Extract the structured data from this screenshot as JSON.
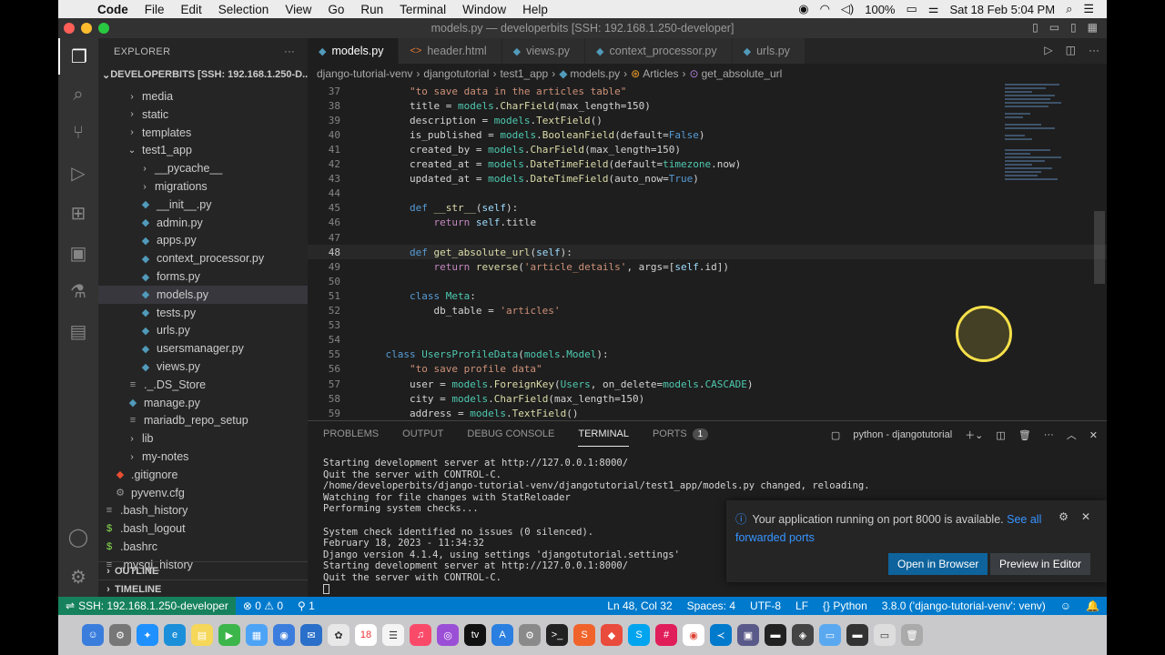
{
  "menubar": {
    "app": "Code",
    "items": [
      "File",
      "Edit",
      "Selection",
      "View",
      "Go",
      "Run",
      "Terminal",
      "Window",
      "Help"
    ],
    "battery": "100%",
    "datetime": "Sat 18 Feb  5:04 PM"
  },
  "window": {
    "title": "models.py — developerbits [SSH: 192.168.1.250-developer]"
  },
  "sidebar": {
    "title": "EXPLORER",
    "root": "DEVELOPERBITS [SSH: 192.168.1.250-D...",
    "items": [
      {
        "label": "media",
        "icon": "folder",
        "expanded": false
      },
      {
        "label": "static",
        "icon": "folder",
        "expanded": false
      },
      {
        "label": "templates",
        "icon": "folder",
        "expanded": false
      },
      {
        "label": "test1_app",
        "icon": "folder",
        "expanded": true
      },
      {
        "label": "__pycache__",
        "icon": "folder",
        "expanded": false
      },
      {
        "label": "migrations",
        "icon": "folder",
        "expanded": false
      },
      {
        "label": "__init__.py",
        "icon": "python"
      },
      {
        "label": "admin.py",
        "icon": "python"
      },
      {
        "label": "apps.py",
        "icon": "python"
      },
      {
        "label": "context_processor.py",
        "icon": "python"
      },
      {
        "label": "forms.py",
        "icon": "python"
      },
      {
        "label": "models.py",
        "icon": "python",
        "selected": true
      },
      {
        "label": "tests.py",
        "icon": "python"
      },
      {
        "label": "urls.py",
        "icon": "python"
      },
      {
        "label": "usersmanager.py",
        "icon": "python"
      },
      {
        "label": "views.py",
        "icon": "python"
      },
      {
        "label": "._.DS_Store",
        "icon": "file"
      },
      {
        "label": "manage.py",
        "icon": "python"
      },
      {
        "label": "mariadb_repo_setup",
        "icon": "file"
      },
      {
        "label": "lib",
        "icon": "folder",
        "expanded": false
      },
      {
        "label": "my-notes",
        "icon": "folder",
        "expanded": false
      },
      {
        "label": ".gitignore",
        "icon": "git"
      },
      {
        "label": "pyvenv.cfg",
        "icon": "gear"
      },
      {
        "label": ".bash_history",
        "icon": "file"
      },
      {
        "label": ".bash_logout",
        "icon": "shell"
      },
      {
        "label": ".bashrc",
        "icon": "shell"
      },
      {
        "label": ".mysql_history",
        "icon": "file"
      }
    ],
    "outline": "OUTLINE",
    "timeline": "TIMELINE"
  },
  "tabs": [
    {
      "label": "models.py",
      "active": true
    },
    {
      "label": "header.html"
    },
    {
      "label": "views.py"
    },
    {
      "label": "context_processor.py"
    },
    {
      "label": "urls.py"
    }
  ],
  "breadcrumbs": [
    "django-tutorial-venv",
    "djangotutorial",
    "test1_app",
    "models.py",
    "Articles",
    "get_absolute_url"
  ],
  "code": [
    {
      "n": "37",
      "t": "        \"to save data in the articles table\""
    },
    {
      "n": "38",
      "t": "        title = models.CharField(max_length=150)"
    },
    {
      "n": "39",
      "t": "        description = models.TextField()"
    },
    {
      "n": "40",
      "t": "        is_published = models.BooleanField(default=False)"
    },
    {
      "n": "41",
      "t": "        created_by = models.CharField(max_length=150)"
    },
    {
      "n": "42",
      "t": "        created_at = models.DateTimeField(default=timezone.now)"
    },
    {
      "n": "43",
      "t": "        updated_at = models.DateTimeField(auto_now=True)"
    },
    {
      "n": "44",
      "t": ""
    },
    {
      "n": "45",
      "t": "        def __str__(self):"
    },
    {
      "n": "46",
      "t": "            return self.title"
    },
    {
      "n": "47",
      "t": ""
    },
    {
      "n": "48",
      "t": "        def get_absolute_url(self):"
    },
    {
      "n": "49",
      "t": "            return reverse('article_details', args=[self.id])"
    },
    {
      "n": "50",
      "t": ""
    },
    {
      "n": "51",
      "t": "        class Meta:"
    },
    {
      "n": "52",
      "t": "            db_table = 'articles'"
    },
    {
      "n": "53",
      "t": ""
    },
    {
      "n": "54",
      "t": ""
    },
    {
      "n": "55",
      "t": "    class UsersProfileData(models.Model):"
    },
    {
      "n": "56",
      "t": "        \"to save profile data\""
    },
    {
      "n": "57",
      "t": "        user = models.ForeignKey(Users, on_delete=models.CASCADE)"
    },
    {
      "n": "58",
      "t": "        city = models.CharField(max_length=150)"
    },
    {
      "n": "59",
      "t": "        address = models.TextField()"
    }
  ],
  "panel": {
    "tabs": [
      "PROBLEMS",
      "OUTPUT",
      "DEBUG CONSOLE",
      "TERMINAL",
      "PORTS"
    ],
    "ports_badge": "1",
    "terminal_name": "python - djangotutorial",
    "terminal_lines": [
      "Starting development server at http://127.0.0.1:8000/",
      "Quit the server with CONTROL-C.",
      "/home/developerbits/django-tutorial-venv/djangotutorial/test1_app/models.py changed, reloading.",
      "Watching for file changes with StatReloader",
      "Performing system checks...",
      "",
      "System check identified no issues (0 silenced).",
      "February 18, 2023 - 11:34:32",
      "Django version 4.1.4, using settings 'djangotutorial.settings'",
      "Starting development server at http://127.0.0.1:8000/",
      "Quit the server with CONTROL-C.",
      ""
    ]
  },
  "notification": {
    "message": "Your application running on port 8000 is available.",
    "link": "See all forwarded ports",
    "primary": "Open in Browser",
    "secondary": "Preview in Editor"
  },
  "status": {
    "remote": "SSH: 192.168.1.250-developer",
    "problems": "⊗ 0 ⚠ 0",
    "ports": "1",
    "position": "Ln 48, Col 32",
    "spaces": "Spaces: 4",
    "encoding": "UTF-8",
    "eol": "LF",
    "language": "Python",
    "interpreter": "3.8.0 ('django-tutorial-venv': venv)"
  },
  "colors": {
    "accent": "#007acc",
    "remote": "#16825d",
    "cursor_highlight": "#f5e04a"
  }
}
